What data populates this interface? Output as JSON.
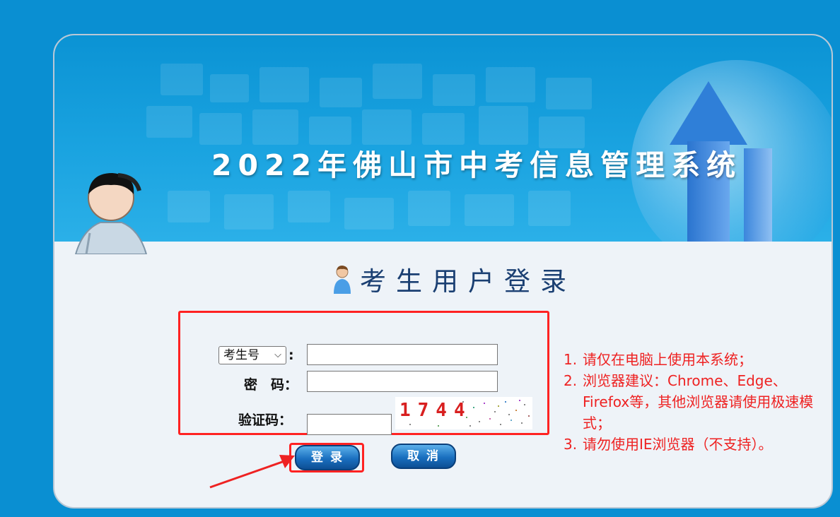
{
  "header": {
    "title": "2022年佛山市中考信息管理系统"
  },
  "login": {
    "heading": "考生用户登录",
    "id_type_select": "考生号",
    "id_type_colon": ":",
    "password_label": "密　码：",
    "captcha_label": "验证码：",
    "captcha_code": "1744",
    "id_value": "",
    "password_value": "",
    "captcha_value": "",
    "login_button": "登录",
    "cancel_button": "取消"
  },
  "notes": [
    {
      "num": "1.",
      "text": "请仅在电脑上使用本系统；"
    },
    {
      "num": "2.",
      "text": "浏览器建议：Chrome、Edge、Firefox等，其他浏览器请使用极速模式；"
    },
    {
      "num": "3.",
      "text": "请勿使用IE浏览器（不支持）。"
    }
  ],
  "colors": {
    "background": "#0a8fd2",
    "annotation_red": "#ff2222",
    "heading_blue": "#1a3f72"
  }
}
